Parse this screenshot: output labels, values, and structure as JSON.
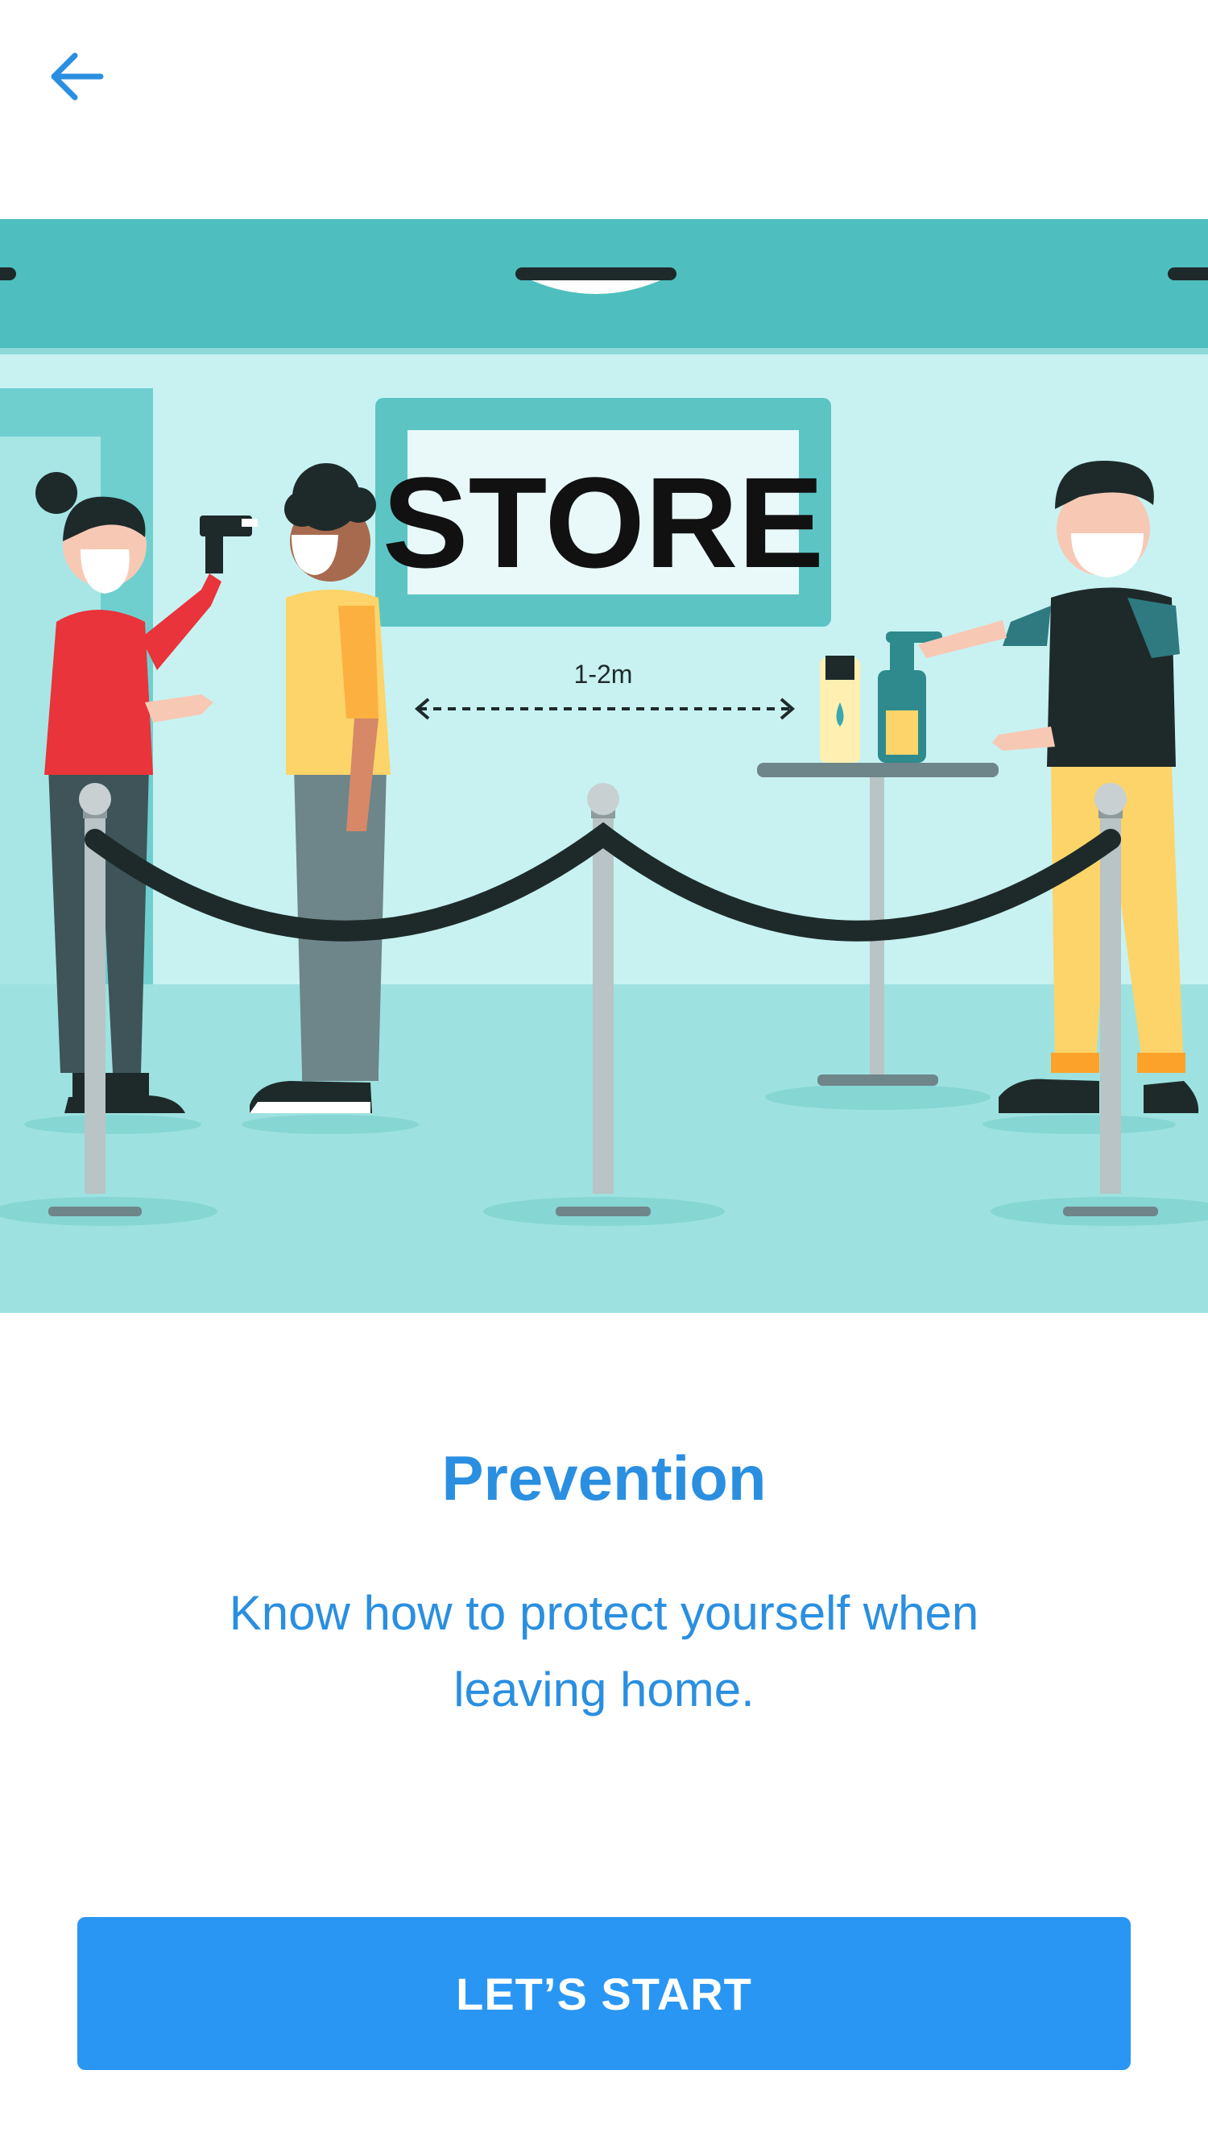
{
  "nav": {
    "back_icon": "arrow-left-icon"
  },
  "illustration": {
    "store_sign": "STORE",
    "distance_label": "1-2m"
  },
  "content": {
    "title": "Prevention",
    "subtitle": "Know how to protect yourself when leaving home."
  },
  "cta": {
    "label": "LET’S START"
  },
  "colors": {
    "accent": "#2A8FE0",
    "button": "#2A96F3",
    "scene_bg": "#C8F2F2",
    "scene_band": "#4EBEBE"
  }
}
